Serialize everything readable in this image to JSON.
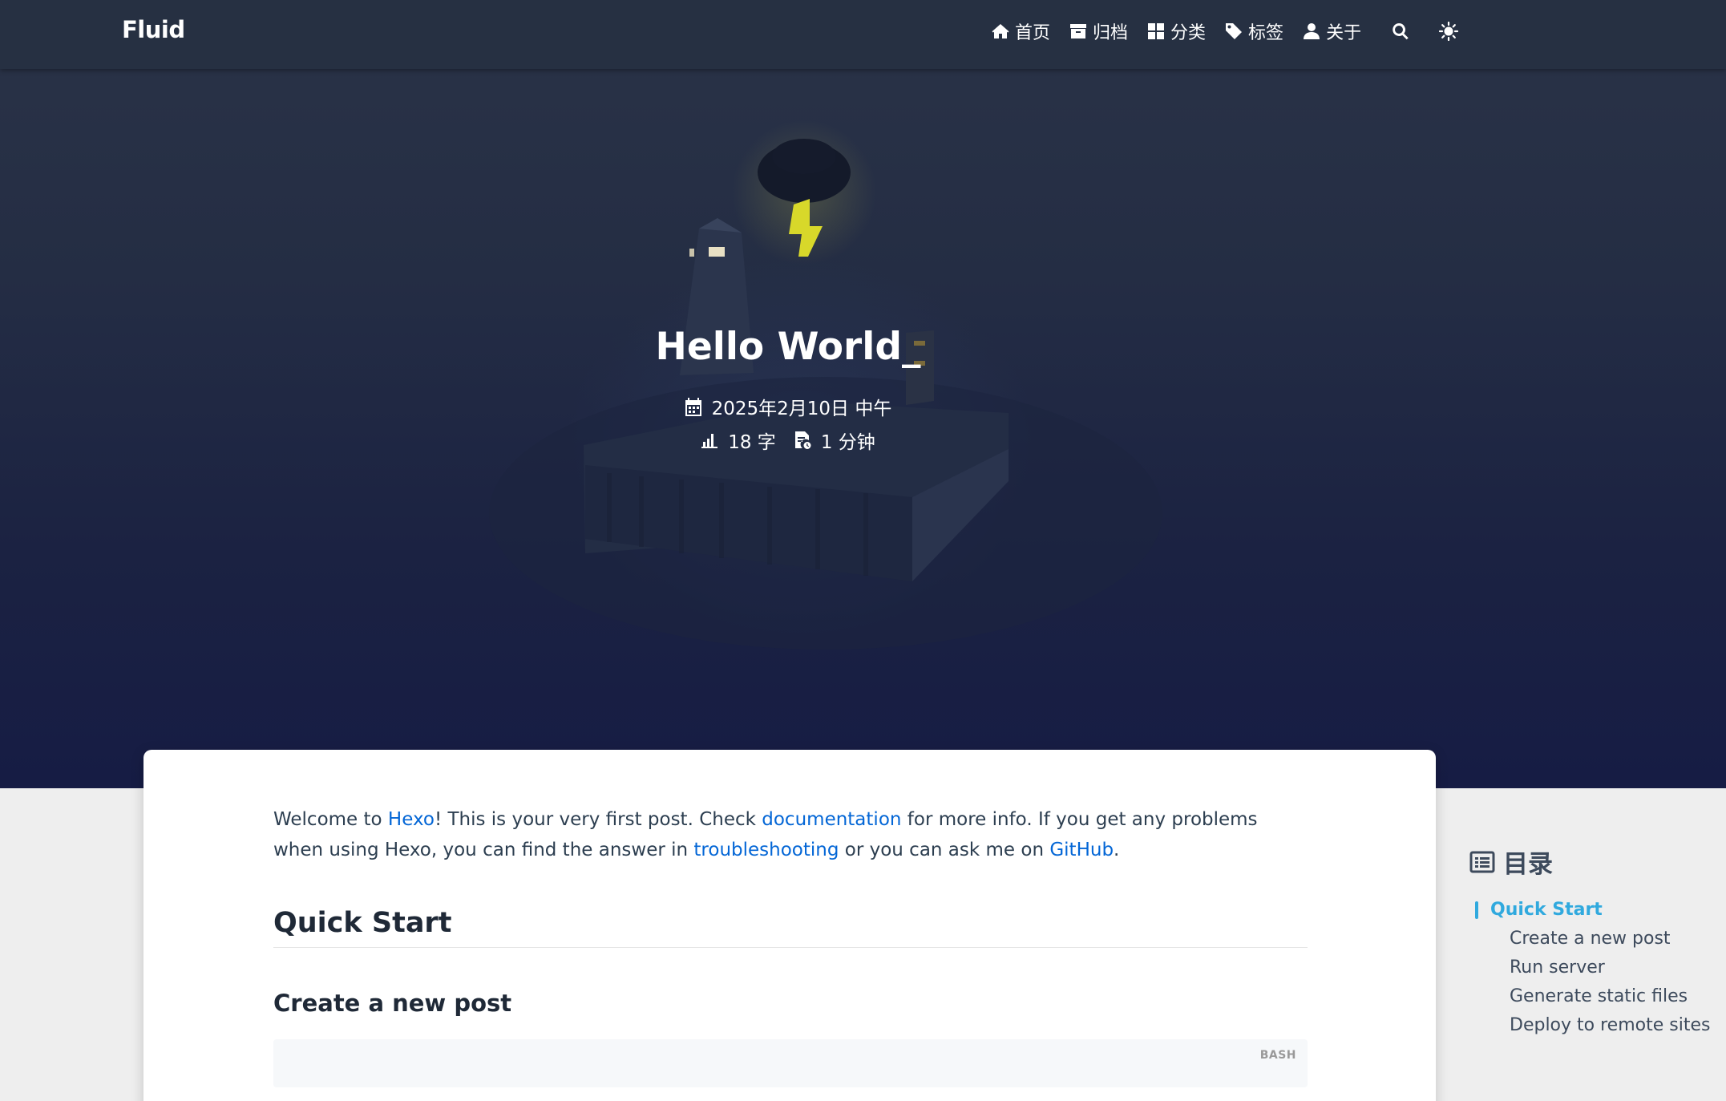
{
  "navbar": {
    "brand": "Fluid",
    "items": [
      {
        "icon": "home-icon",
        "label": "首页"
      },
      {
        "icon": "archive-icon",
        "label": "归档"
      },
      {
        "icon": "category-icon",
        "label": "分类"
      },
      {
        "icon": "tags-icon",
        "label": "标签"
      },
      {
        "icon": "user-icon",
        "label": "关于"
      }
    ],
    "search_icon": "search-icon",
    "theme_icon": "sun-icon"
  },
  "banner": {
    "title": "Hello World_",
    "date": "2025年2月10日 中午",
    "words": "18 字",
    "read_time": "1 分钟"
  },
  "article": {
    "intro": {
      "t1": "Welcome to ",
      "link1": "Hexo",
      "t2": "! This is your very first post. Check ",
      "link2": "documentation",
      "t3": " for more info. If you get any problems when using Hexo, you can find the answer in ",
      "link3": "troubleshooting",
      "t4": " or you can ask me on ",
      "link4": "GitHub",
      "t5": "."
    },
    "h2": "Quick Start",
    "h3": "Create a new post",
    "code_lang": "BASH"
  },
  "toc": {
    "title": "目录",
    "active": "Quick Start",
    "items": [
      "Create a new post",
      "Run server",
      "Generate static files",
      "Deploy to remote sites"
    ]
  },
  "colors": {
    "link": "#0366d6",
    "toc_active": "#30a9de",
    "lightning": "#d8d82a"
  }
}
